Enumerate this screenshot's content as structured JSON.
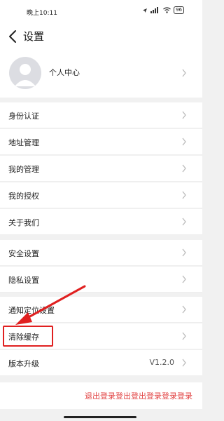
{
  "status": {
    "time": "晚上10:11",
    "battery": "96"
  },
  "nav": {
    "title": "设置"
  },
  "profile": {
    "label": "个人中心"
  },
  "menu": {
    "group1": [
      "身份认证",
      "地址管理",
      "我的管理",
      "我的授权",
      "关于我们"
    ],
    "group2": [
      "安全设置",
      "隐私设置",
      "通知定位设置",
      "清除缓存"
    ],
    "version_label": "版本升级",
    "version_value": "V1.2.0"
  },
  "logout": {
    "label": "退出登录登出登出登录登录登录"
  },
  "colors": {
    "highlight": "#e02020",
    "logout_text": "#e24646"
  }
}
